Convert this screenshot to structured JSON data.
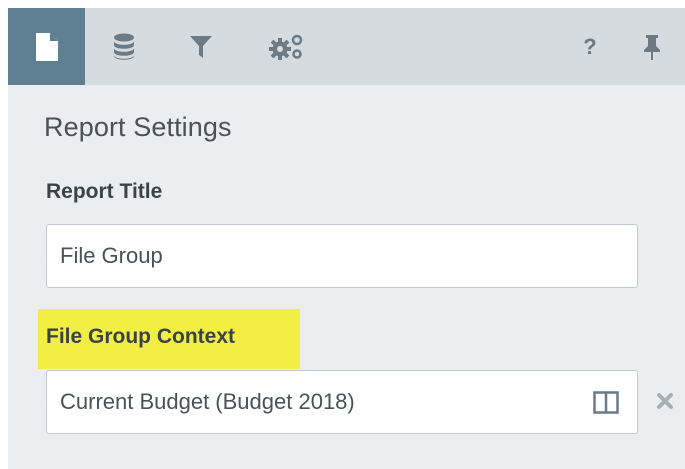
{
  "toolbar": {
    "tabs": [
      {
        "icon": "document-icon",
        "active": true
      },
      {
        "icon": "database-icon",
        "active": false
      },
      {
        "icon": "filter-icon",
        "active": false
      },
      {
        "icon": "gears-icon",
        "active": false
      }
    ],
    "help_label": "?",
    "pin_icon": "pin-icon"
  },
  "settings": {
    "section_title": "Report Settings",
    "report_title_label": "Report Title",
    "report_title_value": "File Group",
    "context_label": "File Group Context",
    "context_value": "Current Budget (Budget 2018)",
    "picker_icon": "columns-icon",
    "clear_icon": "close-icon"
  },
  "colors": {
    "panel_bg": "#ebedf0",
    "toolbar_bg": "#d6dbe0",
    "active_tab_bg": "#5f7f93",
    "highlight": "#f3ee44",
    "text": "#4a5258",
    "icon": "#6c7a85"
  }
}
